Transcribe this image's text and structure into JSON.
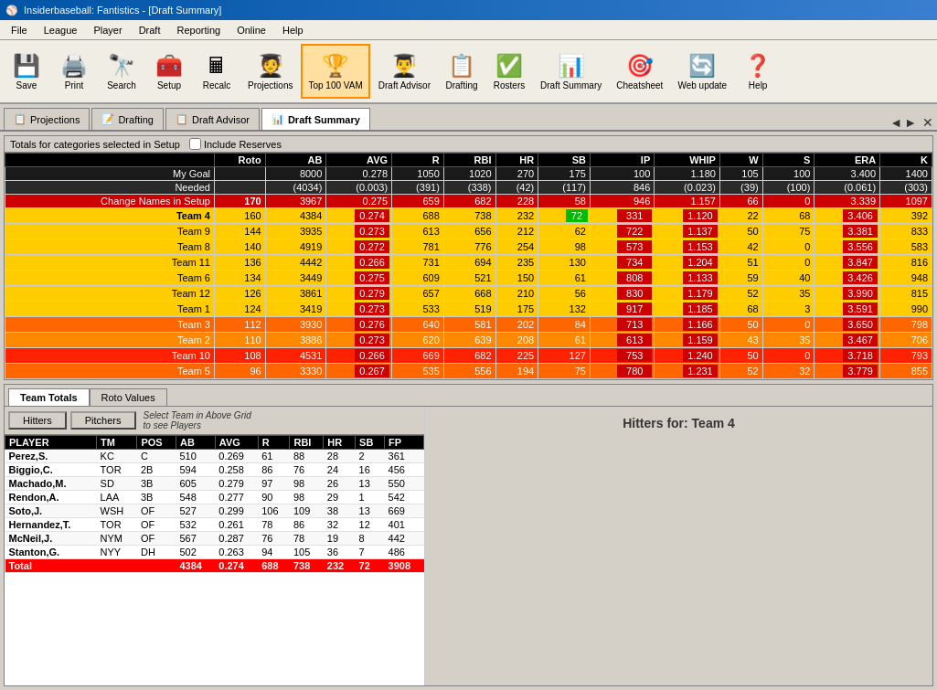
{
  "titleBar": {
    "icon": "⚾",
    "title": "Insiderbaseball: Fantistics - [Draft Summary]"
  },
  "menuBar": {
    "items": [
      "File",
      "League",
      "Player",
      "Draft",
      "Reporting",
      "Online",
      "Help"
    ]
  },
  "toolbar": {
    "buttons": [
      {
        "id": "save",
        "icon": "💾",
        "label": "Save"
      },
      {
        "id": "print",
        "icon": "🖨️",
        "label": "Print"
      },
      {
        "id": "search",
        "icon": "🔭",
        "label": "Search"
      },
      {
        "id": "setup",
        "icon": "🧰",
        "label": "Setup"
      },
      {
        "id": "recalc",
        "icon": "🖩",
        "label": "Recalc"
      },
      {
        "id": "projections",
        "icon": "🧑‍🎓",
        "label": "Projections"
      },
      {
        "id": "top100",
        "icon": "🏆",
        "label": "Top 100 VAM"
      },
      {
        "id": "draftadvisor",
        "icon": "👨‍🎓",
        "label": "Draft Advisor"
      },
      {
        "id": "drafting",
        "icon": "📋",
        "label": "Drafting"
      },
      {
        "id": "rosters",
        "icon": "✅",
        "label": "Rosters"
      },
      {
        "id": "draftsummary",
        "icon": "📊",
        "label": "Draft Summary"
      },
      {
        "id": "cheatsheet",
        "icon": "🎯",
        "label": "Cheatsheet"
      },
      {
        "id": "webupdate",
        "icon": "🔄",
        "label": "Web update"
      },
      {
        "id": "help",
        "icon": "❓",
        "label": "Help"
      }
    ]
  },
  "tabs": [
    {
      "id": "projections",
      "label": "Projections",
      "icon": "📋"
    },
    {
      "id": "drafting",
      "label": "Drafting",
      "icon": "📝"
    },
    {
      "id": "draftadvisor",
      "label": "Draft Advisor",
      "icon": "📋"
    },
    {
      "id": "draftsummary",
      "label": "Draft Summary",
      "icon": "📊",
      "active": true
    }
  ],
  "draftSummary": {
    "title": "Draft Summary",
    "checkboxLabel": "Include Reserves",
    "setupNote": "Totals for categories selected in Setup",
    "columns": [
      "",
      "Roto",
      "AB",
      "AVG",
      "R",
      "RBI",
      "HR",
      "SB",
      "IP",
      "WHIP",
      "W",
      "S",
      "ERA",
      "K"
    ],
    "rows": [
      {
        "label": "My Goal",
        "roto": "",
        "ab": "8000",
        "avg": "0.278",
        "r": "1050",
        "rbi": "1020",
        "hr": "270",
        "sb": "175",
        "ip": "100",
        "whip": "1.180",
        "w": "105",
        "s": "100",
        "era": "3.400",
        "k": "1400",
        "type": "goal"
      },
      {
        "label": "Needed",
        "roto": "",
        "ab": "(4034)",
        "avg": "(0.003)",
        "r": "(391)",
        "rbi": "(338)",
        "hr": "(42)",
        "sb": "(117)",
        "ip": "846",
        "whip": "(0.023)",
        "w": "(39)",
        "s": "(100)",
        "era": "(0.061)",
        "k": "(303)",
        "type": "needed"
      },
      {
        "label": "Change Names in Setup",
        "roto": "170",
        "ab": "3967",
        "avg": "0.275",
        "r": "659",
        "rbi": "682",
        "hr": "228",
        "sb": "58",
        "ip": "946",
        "whip": "1.157",
        "w": "66",
        "s": "0",
        "era": "3.339",
        "k": "1097",
        "type": "change"
      },
      {
        "label": "Team 4",
        "roto": "160",
        "ab": "4384",
        "avg": "0.274",
        "r": "688",
        "rbi": "738",
        "hr": "232",
        "sb": "72",
        "ip": "331",
        "whip": "1.120",
        "w": "22",
        "s": "68",
        "era": "3.406",
        "k": "392",
        "type": "team4"
      },
      {
        "label": "Team 9",
        "roto": "144",
        "ab": "3935",
        "avg": "0.273",
        "r": "613",
        "rbi": "656",
        "hr": "212",
        "sb": "62",
        "ip": "722",
        "whip": "1.137",
        "w": "50",
        "s": "75",
        "era": "3.381",
        "k": "833",
        "type": "team9"
      },
      {
        "label": "Team 8",
        "roto": "140",
        "ab": "4919",
        "avg": "0.272",
        "r": "781",
        "rbi": "776",
        "hr": "254",
        "sb": "98",
        "ip": "573",
        "whip": "1.153",
        "w": "42",
        "s": "0",
        "era": "3.556",
        "k": "583",
        "type": "team8"
      },
      {
        "label": "Team 11",
        "roto": "136",
        "ab": "4442",
        "avg": "0.266",
        "r": "731",
        "rbi": "694",
        "hr": "235",
        "sb": "130",
        "ip": "734",
        "whip": "1.204",
        "w": "51",
        "s": "0",
        "era": "3.847",
        "k": "816",
        "type": "team11"
      },
      {
        "label": "Team 6",
        "roto": "134",
        "ab": "3449",
        "avg": "0.275",
        "r": "609",
        "rbi": "521",
        "hr": "150",
        "sb": "61",
        "ip": "808",
        "whip": "1.133",
        "w": "59",
        "s": "40",
        "era": "3.426",
        "k": "948",
        "type": "team6"
      },
      {
        "label": "Team 12",
        "roto": "126",
        "ab": "3861",
        "avg": "0.279",
        "r": "657",
        "rbi": "668",
        "hr": "210",
        "sb": "56",
        "ip": "830",
        "whip": "1.179",
        "w": "52",
        "s": "35",
        "era": "3.990",
        "k": "815",
        "type": "team12"
      },
      {
        "label": "Team 1",
        "roto": "124",
        "ab": "3419",
        "avg": "0.273",
        "r": "533",
        "rbi": "519",
        "hr": "175",
        "sb": "132",
        "ip": "917",
        "whip": "1.185",
        "w": "68",
        "s": "3",
        "era": "3.591",
        "k": "990",
        "type": "team1"
      },
      {
        "label": "Team 3",
        "roto": "112",
        "ab": "3930",
        "avg": "0.276",
        "r": "640",
        "rbi": "581",
        "hr": "202",
        "sb": "84",
        "ip": "713",
        "whip": "1.166",
        "w": "50",
        "s": "0",
        "era": "3.650",
        "k": "798",
        "type": "team3"
      },
      {
        "label": "Team 2",
        "roto": "110",
        "ab": "3886",
        "avg": "0.273",
        "r": "620",
        "rbi": "639",
        "hr": "208",
        "sb": "61",
        "ip": "613",
        "whip": "1.159",
        "w": "43",
        "s": "35",
        "era": "3.467",
        "k": "706",
        "type": "team2"
      },
      {
        "label": "Team 10",
        "roto": "108",
        "ab": "4531",
        "avg": "0.266",
        "r": "669",
        "rbi": "682",
        "hr": "225",
        "sb": "127",
        "ip": "753",
        "whip": "1.240",
        "w": "50",
        "s": "0",
        "era": "3.718",
        "k": "793",
        "type": "team10"
      },
      {
        "label": "Team 5",
        "roto": "96",
        "ab": "3330",
        "avg": "0.267",
        "r": "535",
        "rbi": "556",
        "hr": "194",
        "sb": "75",
        "ip": "780",
        "whip": "1.231",
        "w": "52",
        "s": "32",
        "era": "3.779",
        "k": "855",
        "type": "team5"
      }
    ]
  },
  "bottomSection": {
    "tabs": [
      "Team Totals",
      "Roto Values"
    ],
    "activeTab": "Team Totals",
    "hitterPitcherTabs": [
      "Hitters",
      "Pitchers"
    ],
    "activeHPTab": "Hitters",
    "note": "Select Team in Above Grid\nto see Players",
    "hittersFor": "Hitters for: Team 4",
    "columns": [
      "PLAYER",
      "TM",
      "POS",
      "AB",
      "AVG",
      "R",
      "RBI",
      "HR",
      "SB",
      "FP"
    ],
    "players": [
      {
        "player": "Perez,S.",
        "tm": "KC",
        "pos": "C",
        "ab": "510",
        "avg": "0.269",
        "r": "61",
        "rbi": "88",
        "hr": "28",
        "sb": "2",
        "fp": "361"
      },
      {
        "player": "Biggio,C.",
        "tm": "TOR",
        "pos": "2B",
        "ab": "594",
        "avg": "0.258",
        "r": "86",
        "rbi": "76",
        "hr": "24",
        "sb": "16",
        "fp": "456"
      },
      {
        "player": "Machado,M.",
        "tm": "SD",
        "pos": "3B",
        "ab": "605",
        "avg": "0.279",
        "r": "97",
        "rbi": "98",
        "hr": "26",
        "sb": "13",
        "fp": "550"
      },
      {
        "player": "Rendon,A.",
        "tm": "LAA",
        "pos": "3B",
        "ab": "548",
        "avg": "0.277",
        "r": "90",
        "rbi": "98",
        "hr": "29",
        "sb": "1",
        "fp": "542"
      },
      {
        "player": "Soto,J.",
        "tm": "WSH",
        "pos": "OF",
        "ab": "527",
        "avg": "0.299",
        "r": "106",
        "rbi": "109",
        "hr": "38",
        "sb": "13",
        "fp": "669"
      },
      {
        "player": "Hernandez,T.",
        "tm": "TOR",
        "pos": "OF",
        "ab": "532",
        "avg": "0.261",
        "r": "78",
        "rbi": "86",
        "hr": "32",
        "sb": "12",
        "fp": "401"
      },
      {
        "player": "McNeil,J.",
        "tm": "NYM",
        "pos": "OF",
        "ab": "567",
        "avg": "0.287",
        "r": "76",
        "rbi": "78",
        "hr": "19",
        "sb": "8",
        "fp": "442"
      },
      {
        "player": "Stanton,G.",
        "tm": "NYY",
        "pos": "DH",
        "ab": "502",
        "avg": "0.263",
        "r": "94",
        "rbi": "105",
        "hr": "36",
        "sb": "7",
        "fp": "486"
      }
    ],
    "total": {
      "player": "Total",
      "ab": "4384",
      "avg": "0.274",
      "r": "688",
      "rbi": "738",
      "hr": "232",
      "sb": "72",
      "fp": "3908"
    }
  }
}
